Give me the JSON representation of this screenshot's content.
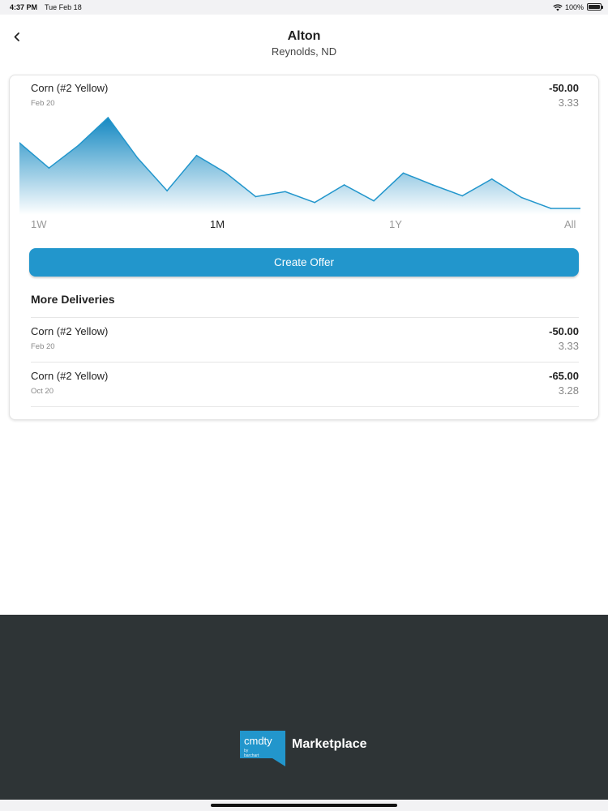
{
  "status_bar": {
    "time": "4:37 PM",
    "date": "Tue Feb 18",
    "battery": "100%"
  },
  "header": {
    "title": "Alton",
    "subtitle": "Reynolds, ND"
  },
  "current": {
    "commodity": "Corn (#2 Yellow)",
    "delivery": "Feb 20",
    "basis": "-50.00",
    "price": "3.33"
  },
  "chart_data": {
    "type": "area",
    "values": [
      78,
      48,
      75,
      108,
      60,
      21,
      63,
      42,
      14,
      20,
      7,
      28,
      9,
      42,
      28,
      15,
      35,
      13,
      0,
      0
    ],
    "color": "#2296cc"
  },
  "ranges": [
    "1W",
    "1M",
    "1Y",
    "All"
  ],
  "active_range": "1M",
  "create_offer_label": "Create Offer",
  "more_deliveries": {
    "title": "More Deliveries",
    "items": [
      {
        "commodity": "Corn (#2 Yellow)",
        "delivery": "Feb 20",
        "basis": "-50.00",
        "price": "3.33"
      },
      {
        "commodity": "Corn (#2 Yellow)",
        "delivery": "Oct 20",
        "basis": "-65.00",
        "price": "3.28"
      }
    ]
  },
  "footer": {
    "logo_text": "cmdty",
    "logo_sub": "by barchart",
    "product": "Marketplace"
  }
}
